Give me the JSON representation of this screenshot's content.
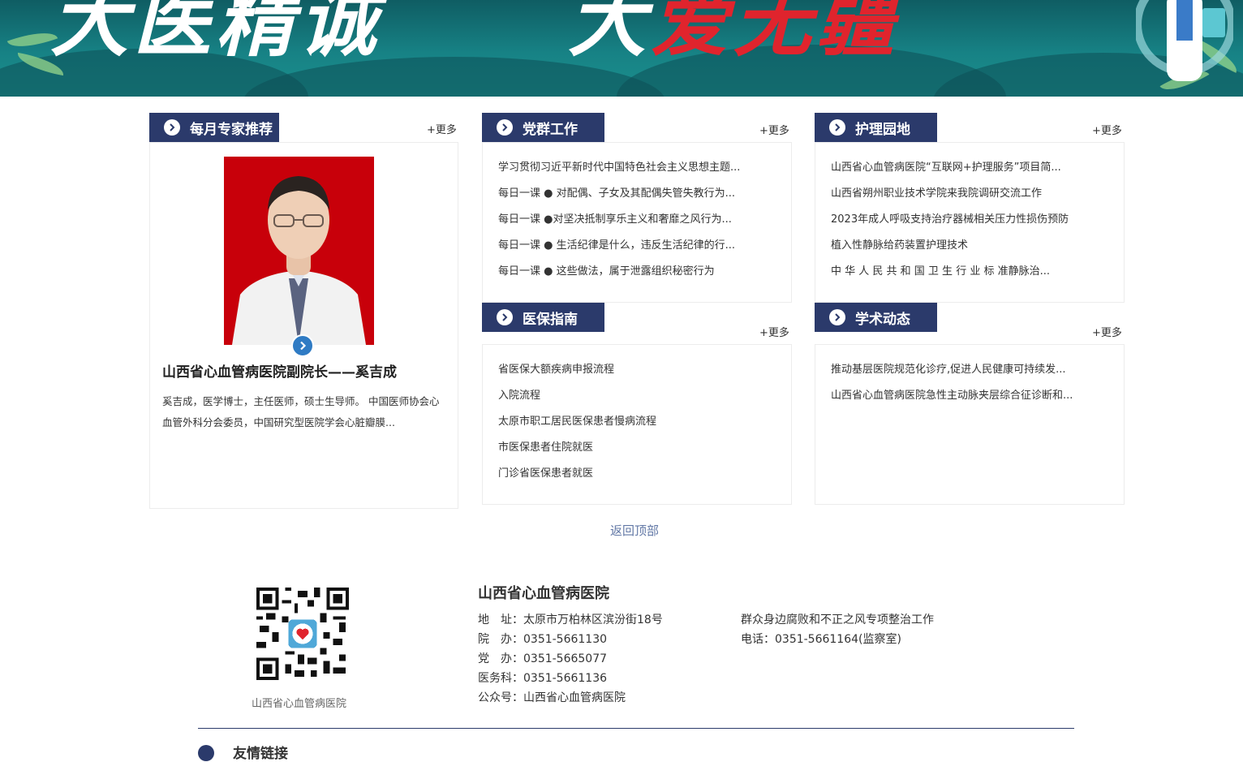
{
  "banner": {
    "slogan_left": "大医精诚",
    "slogan_right_prefix": "大",
    "slogan_right_red": "爱无疆"
  },
  "expert": {
    "tab_label": "每月专家推荐",
    "more_label": "+更多",
    "title": "山西省心血管病医院副院长——奚吉成",
    "description": "奚吉成，医学博士，主任医师，硕士生导师。 中国医师协会心血管外科分会委员，中国研究型医院学会心脏瓣膜..."
  },
  "party": {
    "tab_label": "党群工作",
    "more_label": "+更多",
    "items": [
      "学习贯彻习近平新时代中国特色社会主义思想主题...",
      "每日一课 ● 对配偶、子女及其配偶失管失教行为...",
      "每日一课 ●对坚决抵制享乐主义和奢靡之风行为...",
      "每日一课 ● 生活纪律是什么，违反生活纪律的行...",
      "每日一课 ● 这些做法，属于泄露组织秘密行为"
    ]
  },
  "nursing": {
    "tab_label": "护理园地",
    "more_label": "+更多",
    "items": [
      "山西省心血管病医院“互联网+护理服务”项目简...",
      "山西省朔州职业技术学院来我院调研交流工作",
      "2023年成人呼吸支持治疗器械相关压力性损伤预防",
      "植入性静脉给药装置护理技术",
      "中 华 人 民 共 和 国 卫 生 行 业 标 准静脉治..."
    ]
  },
  "insurance": {
    "tab_label": "医保指南",
    "more_label": "+更多",
    "items": [
      "省医保大额疾病申报流程",
      "入院流程",
      "太原市职工居民医保患者慢病流程",
      "市医保患者住院就医",
      "门诊省医保患者就医"
    ]
  },
  "academic": {
    "tab_label": "学术动态",
    "more_label": "+更多",
    "items": [
      "推动基层医院规范化诊疗,促进人民健康可持续发...",
      "山西省心血管病医院急性主动脉夹层综合征诊断和..."
    ]
  },
  "back_to_top": "返回顶部",
  "footer": {
    "qr_caption": "山西省心血管病医院",
    "org_name": "山西省心血管病医院",
    "address": "地　址：太原市万柏林区滨汾街18号",
    "hospital_office": "院　办：0351-5661130",
    "party_office": "党　办：0351-5665077",
    "medical_affairs": "医务科：0351-5661136",
    "public_account": "公众号：山西省心血管病医院",
    "supervision_title": "群众身边腐败和不正之风专项整治工作",
    "supervision_phone": "电话：0351-5661164(监察室)",
    "links_title": "友情链接"
  },
  "colors": {
    "navy": "#2b3a6b",
    "banner_teal": "#178285",
    "banner_red": "#e0242d",
    "link_blue": "#6278a6"
  },
  "icons": [
    "chevron-right-circle-icon",
    "play-circle-icon",
    "qr-code-icon"
  ]
}
